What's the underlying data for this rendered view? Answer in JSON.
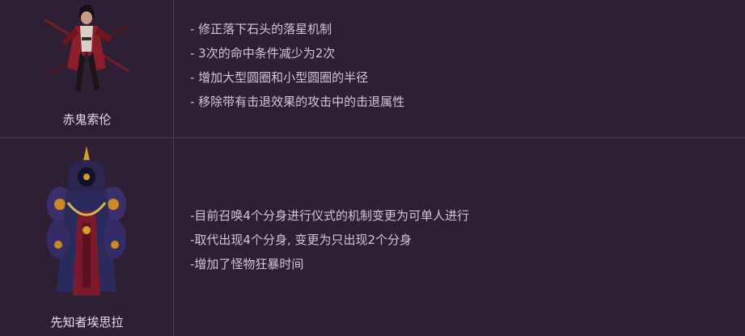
{
  "rows": [
    {
      "name": "赤鬼索伦",
      "notes": [
        "- 修正落下石头的落星机制",
        "- 3次的命中条件减少为2次",
        "- 增加大型圆圈和小型圆圈的半径",
        "- 移除带有击退效果的攻击中的击退属性"
      ]
    },
    {
      "name": "先知者埃思拉",
      "notes": [
        "-目前召唤4个分身进行仪式的机制变更为可单人进行",
        "-取代出现4个分身, 变更为只出现2个分身",
        "-增加了怪物狂暴时间"
      ]
    }
  ],
  "colors": {
    "background": "#2e1f35",
    "border": "#4a3a52",
    "text": "#d3c5d8"
  }
}
